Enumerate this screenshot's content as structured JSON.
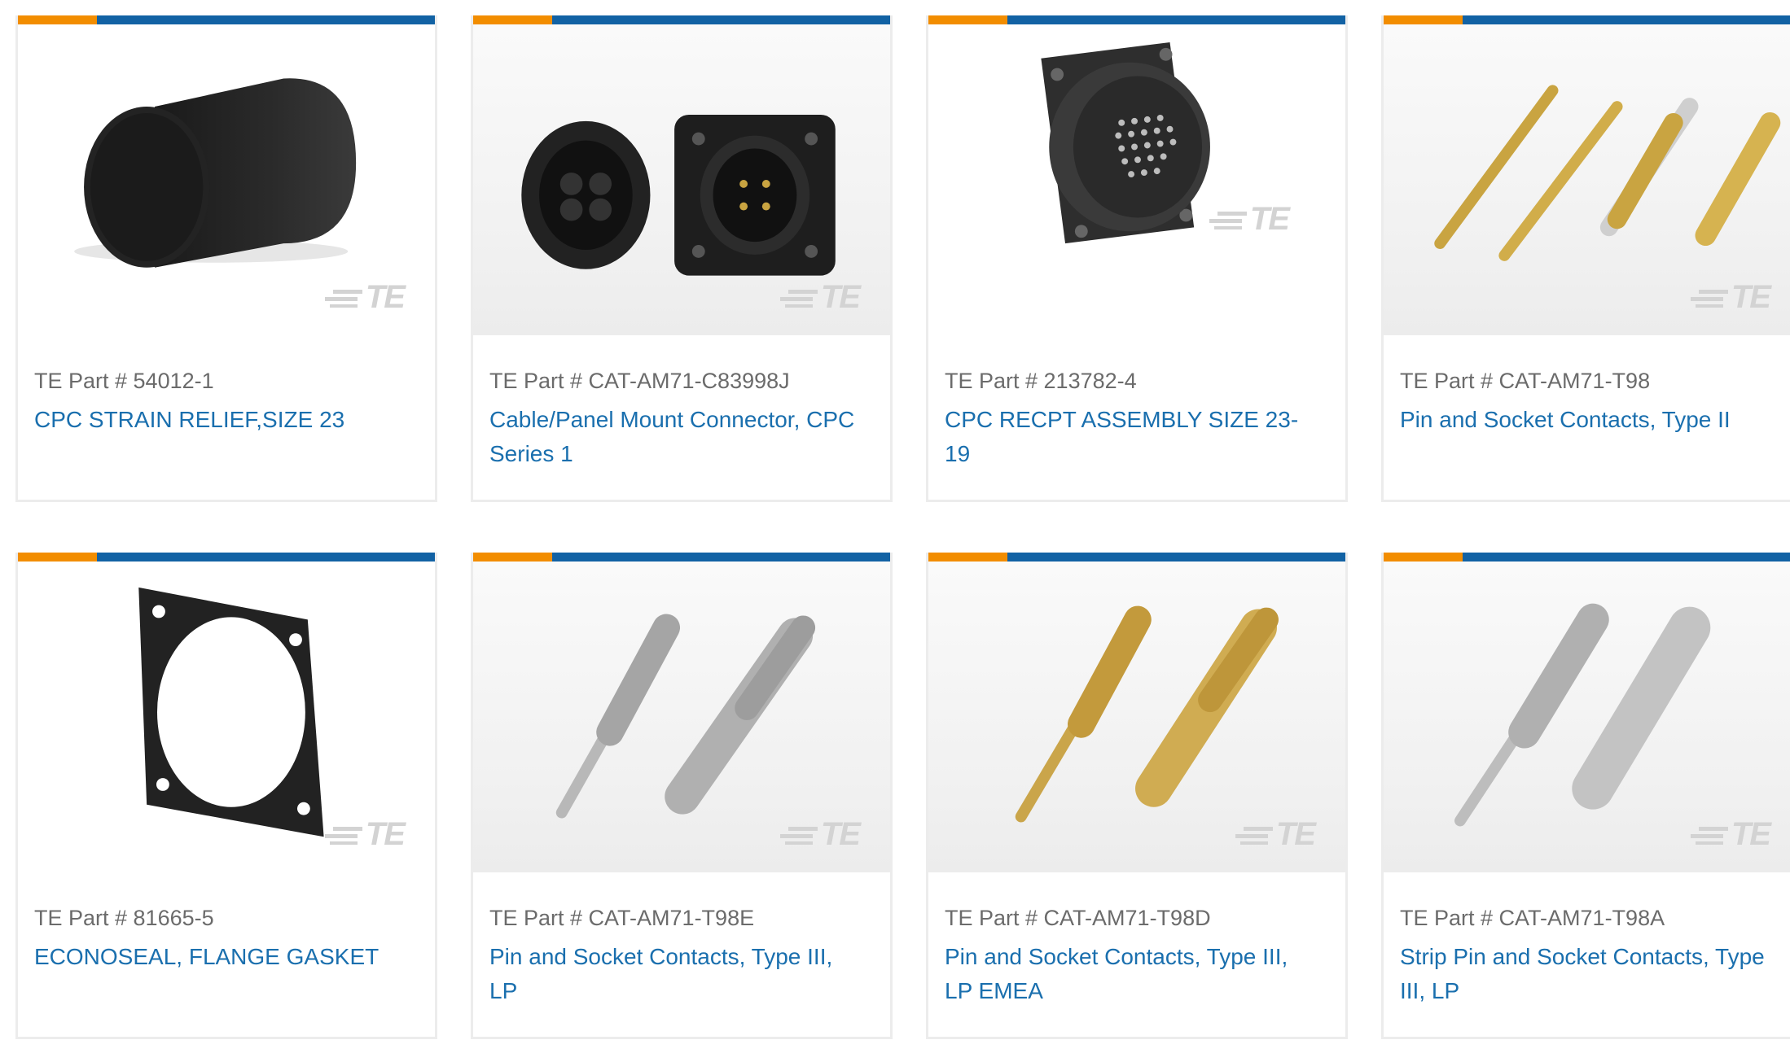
{
  "products": [
    {
      "part_label": "TE Part # 54012-1",
      "title": "CPC STRAIN RELIEF,SIZE 23",
      "image": "strain-relief-image",
      "watermark": "TE"
    },
    {
      "part_label": "TE Part # CAT-AM71-C83998J",
      "title": "Cable/Panel Mount Connector, CPC Series 1",
      "image": "panel-mount-connector-image",
      "watermark": "TE"
    },
    {
      "part_label": "TE Part # 213782-4",
      "title": "CPC RECPT ASSEMBLY SIZE 23-19",
      "image": "receptacle-assembly-image",
      "watermark": "TE"
    },
    {
      "part_label": "TE Part # CAT-AM71-T98",
      "title": "Pin and Socket Contacts, Type II",
      "image": "gold-contacts-image",
      "watermark": "TE"
    },
    {
      "part_label": "TE Part # 81665-5",
      "title": "ECONOSEAL, FLANGE GASKET",
      "image": "flange-gasket-image",
      "watermark": "TE"
    },
    {
      "part_label": "TE Part # CAT-AM71-T98E",
      "title": "Pin and Socket Contacts, Type III, LP",
      "image": "silver-contacts-image",
      "watermark": "TE"
    },
    {
      "part_label": "TE Part # CAT-AM71-T98D",
      "title": "Pin and Socket Contacts, Type III, LP EMEA",
      "image": "gold-crimp-contacts-image",
      "watermark": "TE"
    },
    {
      "part_label": "TE Part # CAT-AM71-T98A",
      "title": "Strip Pin and Socket Contacts, Type III, LP",
      "image": "strip-contacts-image",
      "watermark": "TE"
    }
  ],
  "colors": {
    "accent_orange": "#f28d00",
    "accent_blue": "#1262a4",
    "link": "#1a6fae",
    "part_text": "#6b6b6b"
  }
}
